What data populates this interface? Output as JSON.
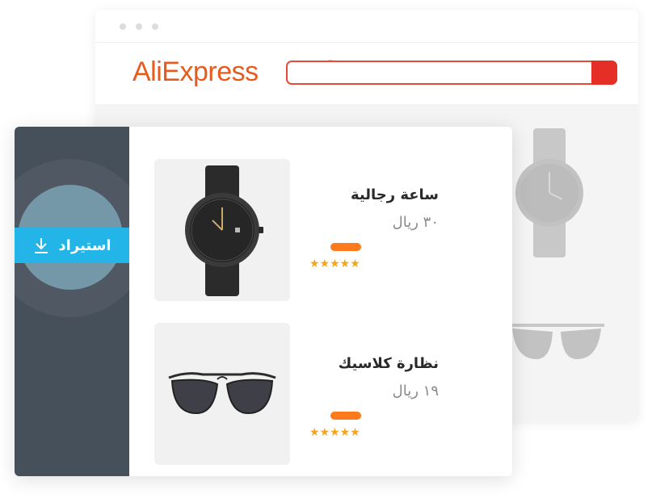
{
  "browser": {
    "logo_part1": "Ali",
    "logo_part2": "Express",
    "logo_mark": "™",
    "search": {
      "placeholder": ""
    }
  },
  "sidebar": {
    "import_label": "استيراد",
    "import_icon": "download-icon"
  },
  "products": [
    {
      "name": "ساعة رجالية",
      "price": "٣٠ ريال",
      "rating": 5,
      "stars": "★★★★★"
    },
    {
      "name": "نظارة كلاسيك",
      "price": "١٩ ريال",
      "rating": 5,
      "stars": "★★★★★"
    }
  ],
  "colors": {
    "brand": "#e85b1f",
    "search_border": "#e84a3a",
    "sidebar_bg": "#46505b",
    "import_button": "#23b4e8",
    "badge": "#ff7a1a",
    "star": "#f6a51a"
  }
}
